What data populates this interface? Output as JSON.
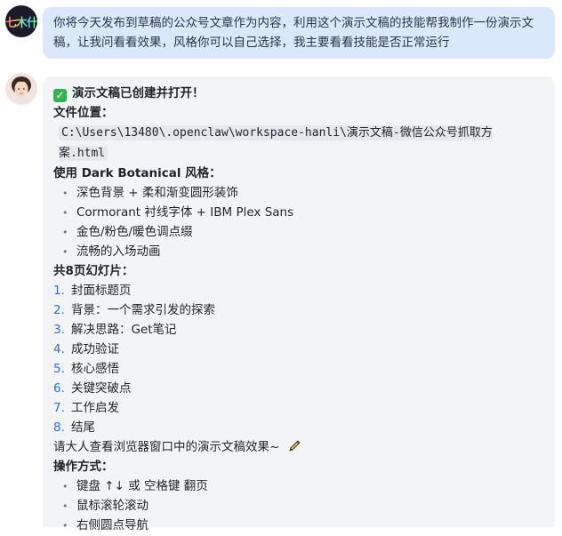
{
  "user_message": {
    "avatar_text": "七木什",
    "text": "你将今天发布到草稿的公众号文章作为内容，利用这个演示文稿的技能帮我制作一份演示文稿，让我问看看效果，风格你可以自己选择，我主要看看技能是否正常运行"
  },
  "assistant_message": {
    "created": "演示文稿已创建并打开！",
    "location_label": "文件位置：",
    "file_path": "C:\\Users\\13480\\.openclaw\\workspace-hanli\\演示文稿-微信公众号抓取方案.html",
    "style_heading": "使用 Dark Botanical 风格：",
    "style_items": [
      "深色背景 + 柔和渐变圆形装饰",
      "Cormorant 衬线字体 + IBM Plex Sans",
      "金色/粉色/暖色调点缀",
      "流畅的入场动画"
    ],
    "slides_heading": "共8页幻灯片：",
    "slides": [
      "封面标题页",
      "背景：一个需求引发的探索",
      "解决思路：Get笔记",
      "成功验证",
      "核心感悟",
      "关键突破点",
      "工作启发",
      "结尾"
    ],
    "view_prompt": "请大人查看浏览器窗口中的演示文稿效果~",
    "ops_heading": "操作方式：",
    "ops_items": [
      "键盘 ↑↓ 或 空格键 翻页",
      "鼠标滚轮滚动",
      "右侧圆点导航"
    ]
  },
  "colors": {
    "user_bubble": "#dbe7fb",
    "bot_bubble": "#f3f4f6",
    "list_number": "#2f6feb",
    "check": "#34b24f"
  }
}
